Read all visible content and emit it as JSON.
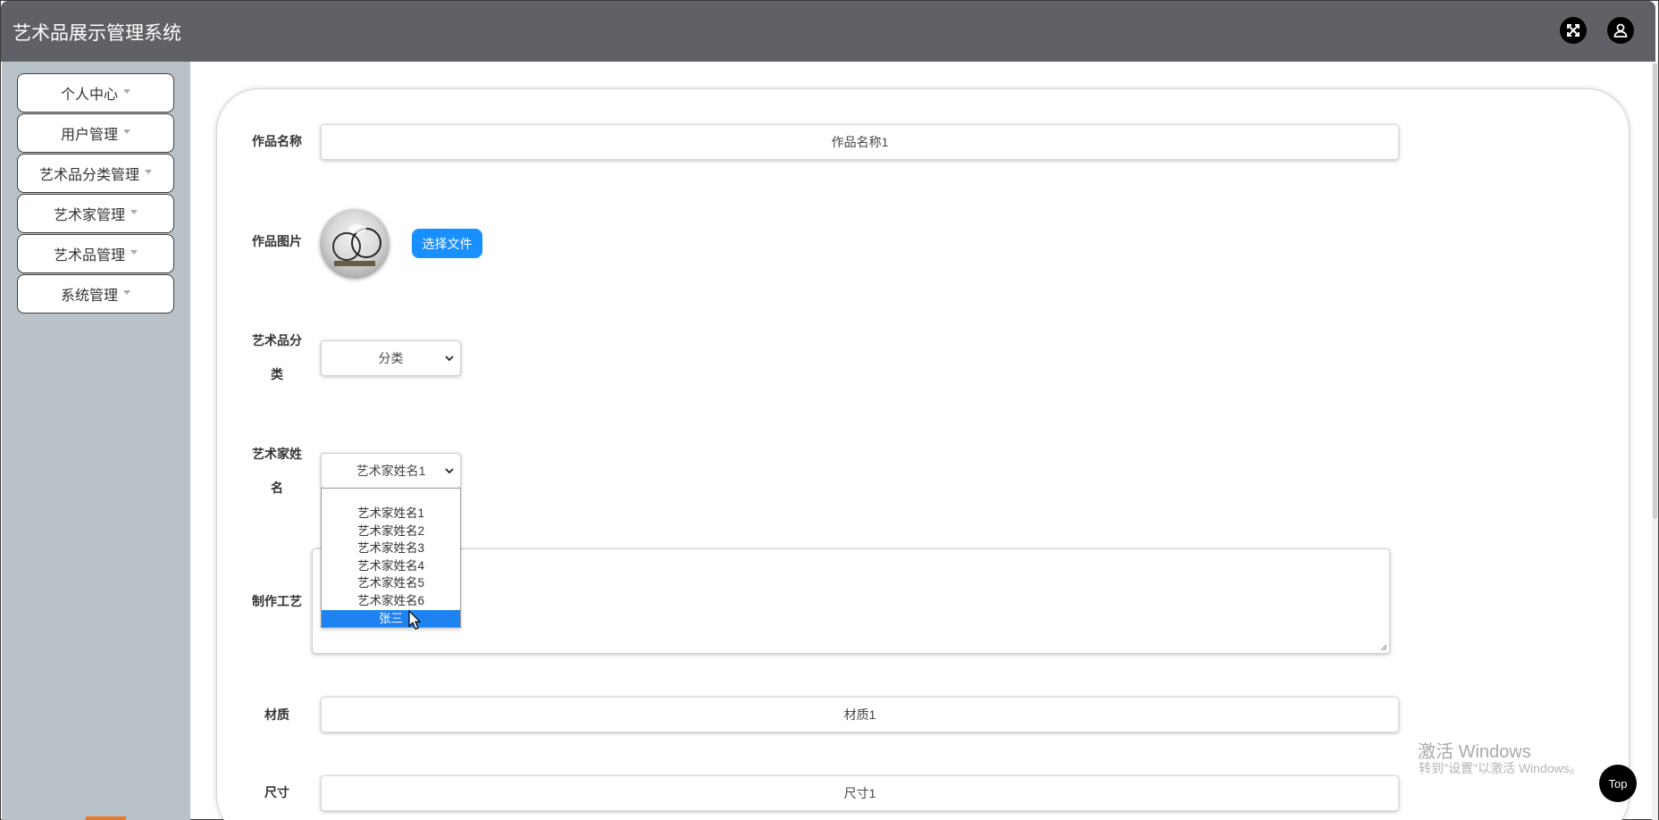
{
  "header": {
    "title": "艺术品展示管理系统",
    "fullscreen_icon": "expand-icon",
    "user_icon": "user-icon"
  },
  "sidebar": {
    "items": [
      {
        "label": "个人中心"
      },
      {
        "label": "用户管理"
      },
      {
        "label": "艺术品分类管理"
      },
      {
        "label": "艺术家管理"
      },
      {
        "label": "艺术品管理"
      },
      {
        "label": "系统管理"
      }
    ]
  },
  "form": {
    "name_label": "作品名称",
    "name_value": "作品名称1",
    "image_label": "作品图片",
    "upload_button": "选择文件",
    "category_label_1": "艺术品分",
    "category_label_2": "类",
    "category_value": "分类",
    "artist_label_1": "艺术家姓",
    "artist_label_2": "名",
    "artist_value": "艺术家姓名1",
    "artist_options": [
      "艺术家姓名1",
      "艺术家姓名2",
      "艺术家姓名3",
      "艺术家姓名4",
      "艺术家姓名5",
      "艺术家姓名6",
      "张三"
    ],
    "artist_highlighted": "张三",
    "craft_label": "制作工艺",
    "material_label": "材质",
    "material_value": "材质1",
    "size_label": "尺寸",
    "size_value": "尺寸1"
  },
  "watermark": {
    "line1": "激活 Windows",
    "line2": "转到\"设置\"以激活 Windows。"
  },
  "top_button": "Top",
  "colors": {
    "header_bg": "#5f6166",
    "sidebar_bg": "#b9c2c9",
    "accent": "#1890ff",
    "highlight": "#1e82f0"
  }
}
